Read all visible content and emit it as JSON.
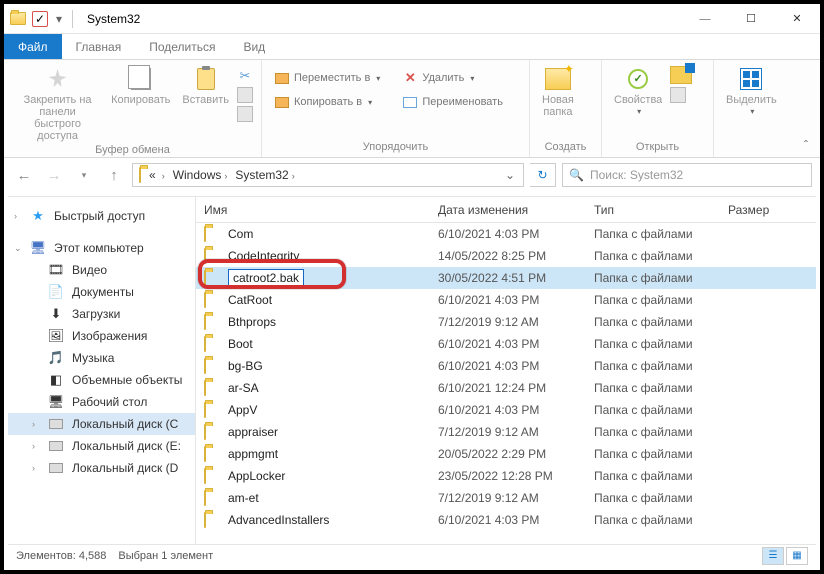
{
  "window": {
    "title": "System32"
  },
  "tabs": {
    "file": "Файл",
    "home": "Главная",
    "share": "Поделиться",
    "view": "Вид"
  },
  "ribbon": {
    "pin": "Закрепить на панели\nбыстрого доступа",
    "copy": "Копировать",
    "paste": "Вставить",
    "clipboard_group": "Буфер обмена",
    "move_to": "Переместить в",
    "copy_to": "Копировать в",
    "delete": "Удалить",
    "rename": "Переименовать",
    "organize_group": "Упорядочить",
    "new_folder": "Новая\nпапка",
    "create_group": "Создать",
    "properties": "Свойства",
    "open_group": "Открыть",
    "select": "Выделить"
  },
  "breadcrumb": {
    "windows": "Windows",
    "system32": "System32"
  },
  "search": {
    "placeholder": "Поиск: System32"
  },
  "sidebar": {
    "quick": "Быстрый доступ",
    "thispc": "Этот компьютер",
    "videos": "Видео",
    "documents": "Документы",
    "downloads": "Загрузки",
    "pictures": "Изображения",
    "music": "Музыка",
    "objects3d": "Объемные объекты",
    "desktop": "Рабочий стол",
    "diskC": "Локальный диск (C",
    "diskE": "Локальный диск (E:",
    "diskD": "Локальный диск (D"
  },
  "columns": {
    "name": "Имя",
    "date": "Дата изменения",
    "type": "Тип",
    "size": "Размер"
  },
  "type_folder": "Папка с файлами",
  "rows": [
    {
      "name": "Com",
      "date": "6/10/2021 4:03 PM"
    },
    {
      "name": "CodeIntegrity",
      "date": "14/05/2022 8:25 PM"
    },
    {
      "name": "catroot2.bak",
      "date": "30/05/2022 4:51 PM",
      "editing": true
    },
    {
      "name": "CatRoot",
      "date": "6/10/2021 4:03 PM"
    },
    {
      "name": "Bthprops",
      "date": "7/12/2019 9:12 AM"
    },
    {
      "name": "Boot",
      "date": "6/10/2021 4:03 PM"
    },
    {
      "name": "bg-BG",
      "date": "6/10/2021 4:03 PM"
    },
    {
      "name": "ar-SA",
      "date": "6/10/2021 12:24 PM"
    },
    {
      "name": "AppV",
      "date": "6/10/2021 4:03 PM"
    },
    {
      "name": "appraiser",
      "date": "7/12/2019 9:12 AM"
    },
    {
      "name": "appmgmt",
      "date": "20/05/2022 2:29 PM"
    },
    {
      "name": "AppLocker",
      "date": "23/05/2022 12:28 PM"
    },
    {
      "name": "am-et",
      "date": "7/12/2019 9:12 AM"
    },
    {
      "name": "AdvancedInstallers",
      "date": "6/10/2021 4:03 PM"
    }
  ],
  "status": {
    "count_label": "Элементов: 4,588",
    "selected": "Выбран 1 элемент"
  }
}
